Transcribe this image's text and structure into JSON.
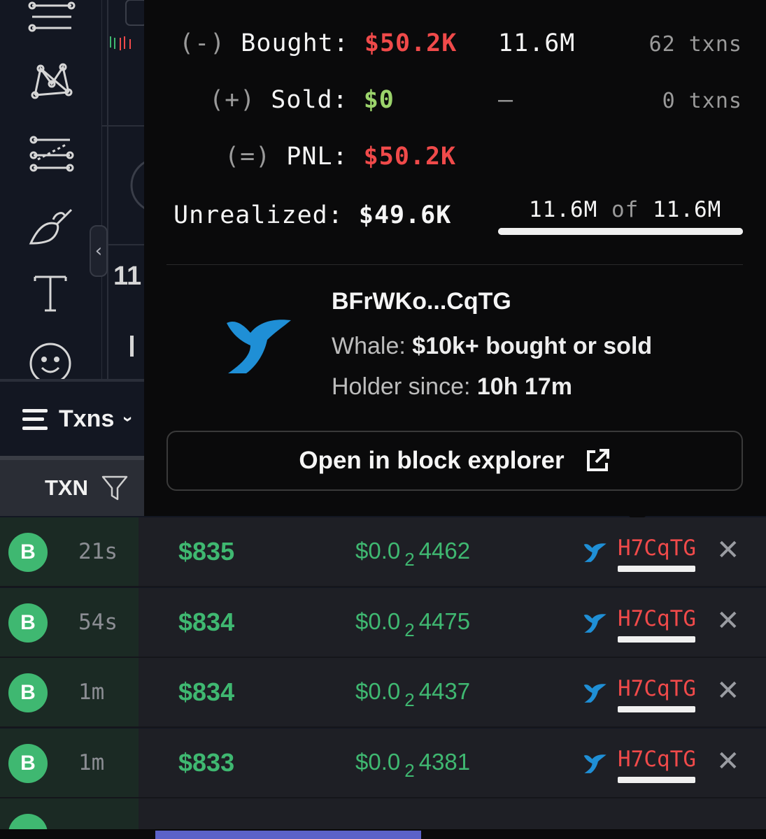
{
  "toolbar": {
    "tools": [
      {
        "icon": "horizontal-lines-icon"
      },
      {
        "icon": "pattern-icon"
      },
      {
        "icon": "fib-retracement-icon"
      },
      {
        "icon": "brush-icon"
      },
      {
        "icon": "text-tool-icon"
      },
      {
        "icon": "emoji-icon"
      }
    ],
    "collapse_glyph": "‹"
  },
  "chart_peek": {
    "price_fragment": "11"
  },
  "txns": {
    "title": "Txns",
    "column_txn": "TXN"
  },
  "popover": {
    "bought": {
      "sign": "(-)",
      "label": "Bought:",
      "usd": "$50.2K",
      "tokens": "11.6M",
      "txns": "62 txns"
    },
    "sold": {
      "sign": "(+)",
      "label": "Sold:",
      "usd": "$0",
      "tokens": "—",
      "txns": "0 txns"
    },
    "pnl": {
      "sign": "(=)",
      "label": "PNL:",
      "usd": "$50.2K"
    },
    "unrealized": {
      "label": "Unrealized:",
      "usd": "$49.6K",
      "held": "11.6M",
      "of": "of",
      "total": "11.6M",
      "held_fraction": 1.0
    },
    "holder": {
      "address": "BFrWKo...CqTG",
      "whale_label": "Whale:",
      "whale_desc": "$10k+ bought or sold",
      "since_label": "Holder since:",
      "since_value": "10h 17m"
    },
    "explorer_button": "Open in block explorer"
  },
  "rows": [
    {
      "type": "B",
      "age": "21s",
      "usd": "$835",
      "price_prefix": "$0.0",
      "price_zeros": "2",
      "price_digits": "4462",
      "maker": "H7CqTG"
    },
    {
      "type": "B",
      "age": "54s",
      "usd": "$834",
      "price_prefix": "$0.0",
      "price_zeros": "2",
      "price_digits": "4475",
      "maker": "H7CqTG"
    },
    {
      "type": "B",
      "age": "1m",
      "usd": "$834",
      "price_prefix": "$0.0",
      "price_zeros": "2",
      "price_digits": "4437",
      "maker": "H7CqTG"
    },
    {
      "type": "B",
      "age": "1m",
      "usd": "$833",
      "price_prefix": "$0.0",
      "price_zeros": "2",
      "price_digits": "4381",
      "maker": "H7CqTG"
    }
  ],
  "colors": {
    "buy": "#3fb871",
    "sell": "#f04a4a",
    "whale": "#1f8fd6"
  }
}
